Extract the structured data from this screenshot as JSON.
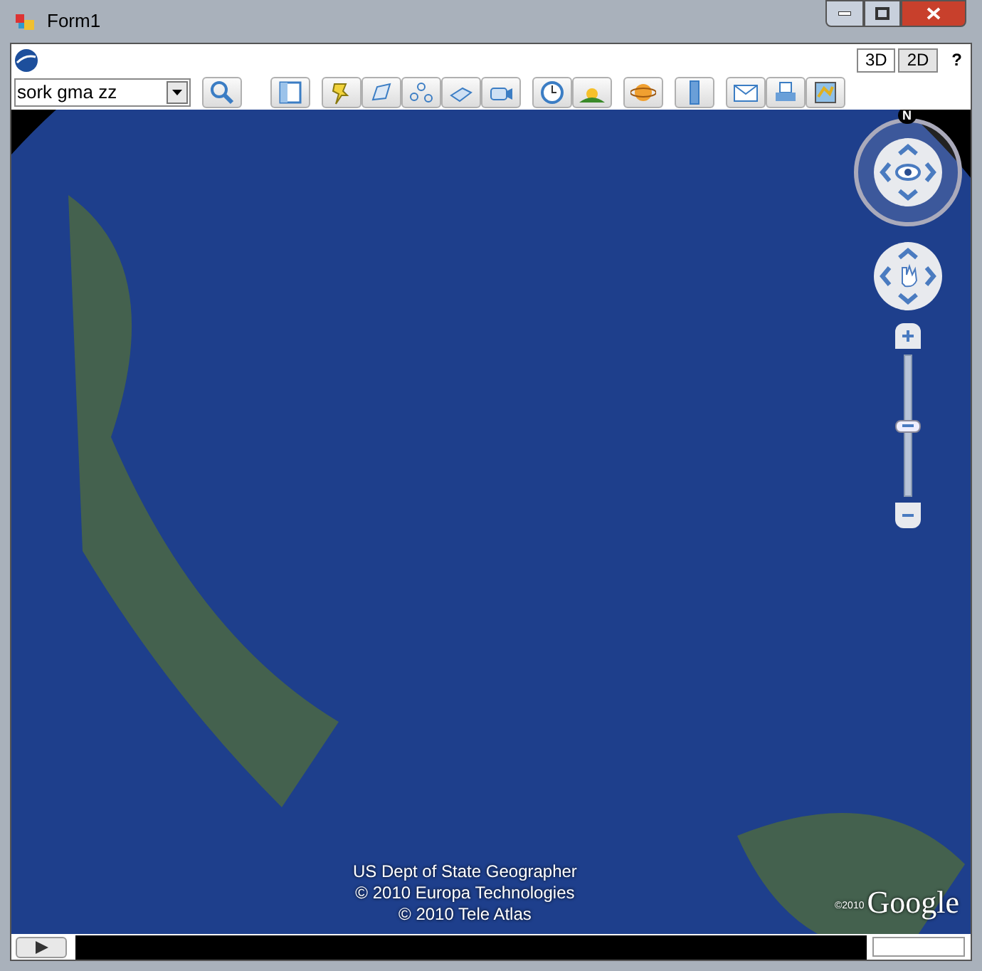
{
  "window": {
    "title": "Form1"
  },
  "view_modes": [
    {
      "label": "3D",
      "selected": false
    },
    {
      "label": "2D",
      "selected": true
    }
  ],
  "help": "?",
  "search": {
    "value": "sork gma zz"
  },
  "zoom": {
    "level": 0.5
  },
  "compass": "N",
  "attribution": [
    "US Dept of State Geographer",
    "© 2010 Europa Technologies",
    "© 2010 Tele Atlas"
  ],
  "logo": {
    "year": "©2010",
    "name": "Google"
  }
}
